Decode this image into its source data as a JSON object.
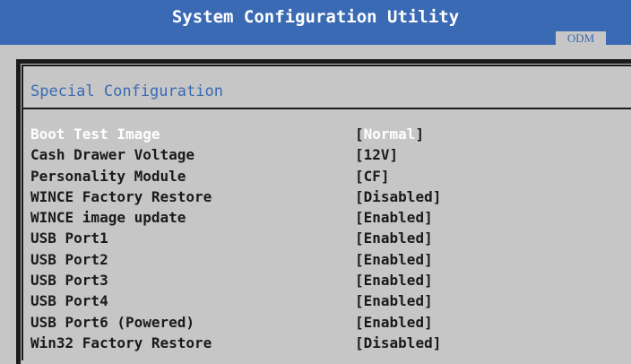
{
  "window": {
    "title": "System Configuration Utility",
    "tab_label": "ODM"
  },
  "section": {
    "title": "Special Configuration"
  },
  "settings": [
    {
      "label": "Boot Test Image",
      "value": "Normal",
      "selected": true
    },
    {
      "label": "Cash Drawer Voltage",
      "value": "12V"
    },
    {
      "label": "Personality Module",
      "value": "CF"
    },
    {
      "label": "WINCE Factory Restore",
      "value": "Disabled"
    },
    {
      "label": "WINCE image update",
      "value": "Enabled"
    },
    {
      "label": "USB Port1",
      "value": "Enabled"
    },
    {
      "label": "USB Port2",
      "value": "Enabled"
    },
    {
      "label": "USB Port3",
      "value": "Enabled"
    },
    {
      "label": "USB Port4",
      "value": "Enabled"
    },
    {
      "label": "USB Port6 (Powered)",
      "value": "Enabled"
    },
    {
      "label": "Win32 Factory Restore",
      "value": "Disabled"
    }
  ],
  "colors": {
    "accent": "#3a6ab3",
    "background": "#c6c6c6",
    "text": "#1a1a1a",
    "highlight_text": "#ffffff"
  }
}
